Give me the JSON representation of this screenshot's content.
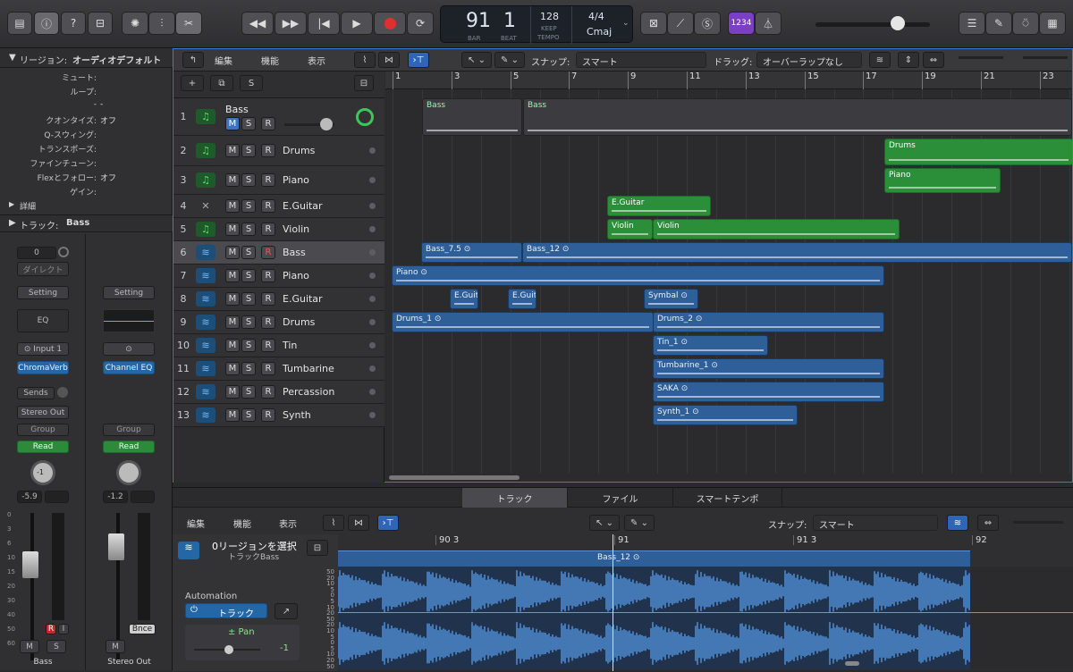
{
  "toolbar": {
    "lcd_bar": "91",
    "lcd_beat": "1",
    "lcd_bar_label": "BAR",
    "lcd_beat_label": "BEAT",
    "lcd_tempo": "128",
    "lcd_keep": "KEEP",
    "lcd_tempo_label": "TEMPO",
    "lcd_sig": "4/4",
    "lcd_key": "Cmaj",
    "count_in": "1234"
  },
  "inspector": {
    "region_header": "リージョン:",
    "region_value": "オーディオデフォルト",
    "rows": [
      {
        "label": "ミュート:",
        "value": ""
      },
      {
        "label": "ループ:",
        "value": ""
      },
      {
        "label": "-",
        "value": "-"
      },
      {
        "label": "クオンタイズ:",
        "value": "オフ"
      },
      {
        "label": "Q-スウィング:",
        "value": ""
      },
      {
        "label": "トランスポーズ:",
        "value": ""
      },
      {
        "label": "ファインチューン:",
        "value": ""
      },
      {
        "label": "Flexとフォロー:",
        "value": "オフ"
      },
      {
        "label": "ゲイン:",
        "value": ""
      }
    ],
    "details": "詳細",
    "track_header": "トラック:",
    "track_value": "Bass"
  },
  "strip1": {
    "value": "0",
    "direct": "ダイレクト",
    "setting": "Setting",
    "eq": "EQ",
    "input": "Input 1",
    "plugin": "ChromaVerb",
    "sends": "Sends",
    "out": "Stereo Out",
    "group": "Group",
    "read": "Read",
    "pan": "-1",
    "vol": "-5.9",
    "r": "R",
    "i": "I",
    "m": "M",
    "s": "S",
    "name": "Bass",
    "scale": [
      "0",
      "3",
      "6",
      "10",
      "15",
      "20",
      "30",
      "40",
      "50",
      "60"
    ]
  },
  "strip2": {
    "setting": "Setting",
    "plugin": "Channel EQ",
    "group": "Group",
    "read": "Read",
    "pan": "",
    "vol": "-1.2",
    "bnce": "Bnce",
    "m": "M",
    "name": "Stereo Out"
  },
  "localbar": {
    "edit": "編集",
    "func": "機能",
    "view": "表示",
    "snap_label": "スナップ:",
    "snap": "スマート",
    "drag_label": "ドラッグ:",
    "drag": "オーバーラップなし"
  },
  "ruler": [
    "1",
    "3",
    "5",
    "7",
    "9",
    "11",
    "13",
    "15",
    "17",
    "19",
    "21",
    "23"
  ],
  "tracks": [
    {
      "n": "1",
      "name": "Bass",
      "type": "midi"
    },
    {
      "n": "2",
      "name": "Drums",
      "type": "midi"
    },
    {
      "n": "3",
      "name": "Piano",
      "type": "midi"
    },
    {
      "n": "4",
      "name": "E.Guitar",
      "type": "drm"
    },
    {
      "n": "5",
      "name": "Violin",
      "type": "midi"
    },
    {
      "n": "6",
      "name": "Bass",
      "type": "aud"
    },
    {
      "n": "7",
      "name": "Piano",
      "type": "aud"
    },
    {
      "n": "8",
      "name": "E.Guitar",
      "type": "aud"
    },
    {
      "n": "9",
      "name": "Drums",
      "type": "aud"
    },
    {
      "n": "10",
      "name": "Tin",
      "type": "aud"
    },
    {
      "n": "11",
      "name": "Tumbarine",
      "type": "aud"
    },
    {
      "n": "12",
      "name": "Percassion",
      "type": "aud"
    },
    {
      "n": "13",
      "name": "Synth",
      "type": "aud"
    }
  ],
  "regions": [
    {
      "name": "Bass",
      "c": "gr"
    },
    {
      "name": "Bass",
      "c": "gr"
    },
    {
      "name": "Drums",
      "c": "g"
    },
    {
      "name": "Piano",
      "c": "g"
    },
    {
      "name": "E.Guitar",
      "c": "g"
    },
    {
      "name": "Violin",
      "c": "g"
    },
    {
      "name": "Violin",
      "c": "g"
    },
    {
      "name": "Bass_7.5 ⊙",
      "c": "b"
    },
    {
      "name": "Bass_12 ⊙",
      "c": "b"
    },
    {
      "name": "Piano ⊙",
      "c": "b"
    },
    {
      "name": "E.Guit",
      "c": "b"
    },
    {
      "name": "E.Guit",
      "c": "b"
    },
    {
      "name": "Symbal ⊙",
      "c": "b"
    },
    {
      "name": "Drums_1 ⊙",
      "c": "b"
    },
    {
      "name": "Drums_2 ⊙",
      "c": "b"
    },
    {
      "name": "Tin_1 ⊙",
      "c": "b"
    },
    {
      "name": "Tumbarine_1 ⊙",
      "c": "b"
    },
    {
      "name": "SAKA ⊙",
      "c": "b"
    },
    {
      "name": "Synth_1 ⊙",
      "c": "b"
    }
  ],
  "bottom": {
    "tabs": [
      "トラック",
      "ファイル",
      "スマートテンポ"
    ],
    "edit": "編集",
    "func": "機能",
    "view": "表示",
    "snap_label": "スナップ:",
    "snap": "スマート",
    "sel": "0リージョンを選択",
    "track": "トラックBass",
    "automation": "Automation",
    "auto_mode": "トラック",
    "pan": "± Pan",
    "pan_val": "-1",
    "ruler": [
      "90 3",
      "91",
      "91 3",
      "92"
    ],
    "region": "Bass_12 ⊙",
    "db": [
      "50",
      "20",
      "10",
      "5",
      "0",
      "5",
      "10",
      "20",
      "50",
      "20",
      "10",
      "5",
      "0",
      "5",
      "10",
      "20",
      "50"
    ]
  }
}
